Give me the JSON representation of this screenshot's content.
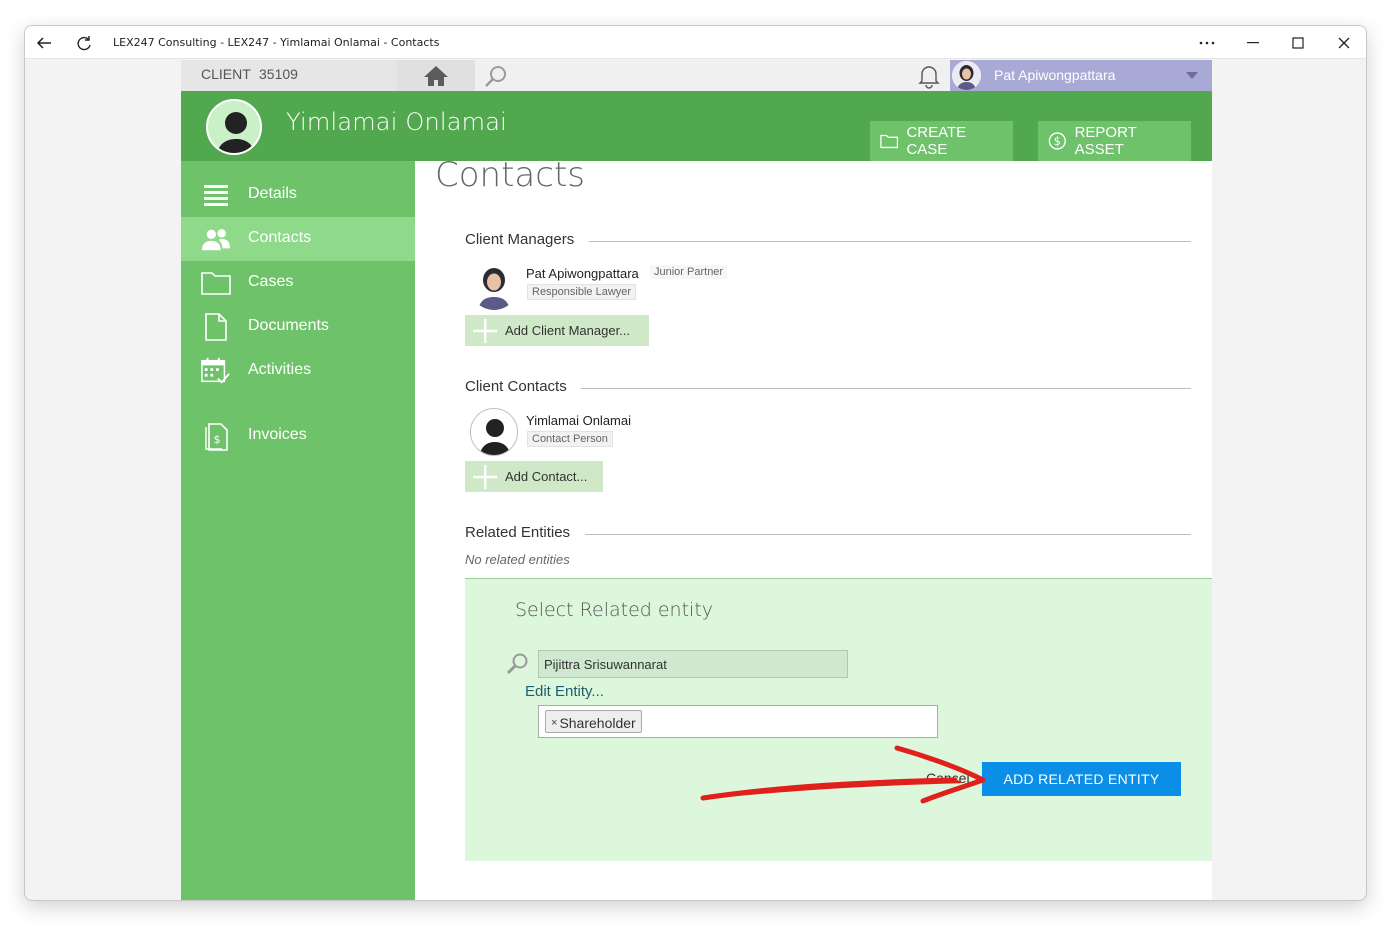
{
  "window": {
    "title": "LEX247 Consulting - LEX247 - Yimlamai Onlamai - Contacts"
  },
  "topbar": {
    "client_label": "CLIENT",
    "client_id": "35109",
    "user_name": "Pat Apiwongpattara"
  },
  "header": {
    "client_name": "Yimlamai Onlamai",
    "create_case_label": "CREATE CASE",
    "report_asset_label": "REPORT ASSET"
  },
  "sidebar": {
    "items": [
      {
        "label": "Details",
        "icon": "list-icon"
      },
      {
        "label": "Contacts",
        "icon": "people-icon",
        "active": true
      },
      {
        "label": "Cases",
        "icon": "folder-icon"
      },
      {
        "label": "Documents",
        "icon": "document-icon"
      },
      {
        "label": "Activities",
        "icon": "calendar-icon"
      },
      {
        "label": "Invoices",
        "icon": "invoice-icon"
      }
    ]
  },
  "main": {
    "page_title": "Contacts",
    "client_managers": {
      "heading": "Client Managers",
      "person_name": "Pat Apiwongpattara",
      "person_title": "Junior Partner",
      "person_role": "Responsible Lawyer",
      "add_label": "Add Client Manager..."
    },
    "client_contacts": {
      "heading": "Client Contacts",
      "person_name": "Yimlamai Onlamai",
      "person_role": "Contact Person",
      "add_label": "Add Contact..."
    },
    "related_entities": {
      "heading": "Related Entities",
      "empty_text": "No related entities"
    },
    "select_related": {
      "title": "Select Related entity",
      "search_value": "Pijittra Srisuwannarat",
      "edit_label": "Edit Entity...",
      "tag_label": "Shareholder",
      "tag_remove": "×",
      "cancel_label": "Cancel",
      "add_button_label": "ADD RELATED ENTITY"
    }
  },
  "colors": {
    "header_green": "#52a84e",
    "sidebar_green": "#6ec36a",
    "active_green": "#8ed98a",
    "panel_green": "#ddf7dd",
    "primary_blue": "#0a8ee8",
    "annotation_red": "#e0201b"
  }
}
